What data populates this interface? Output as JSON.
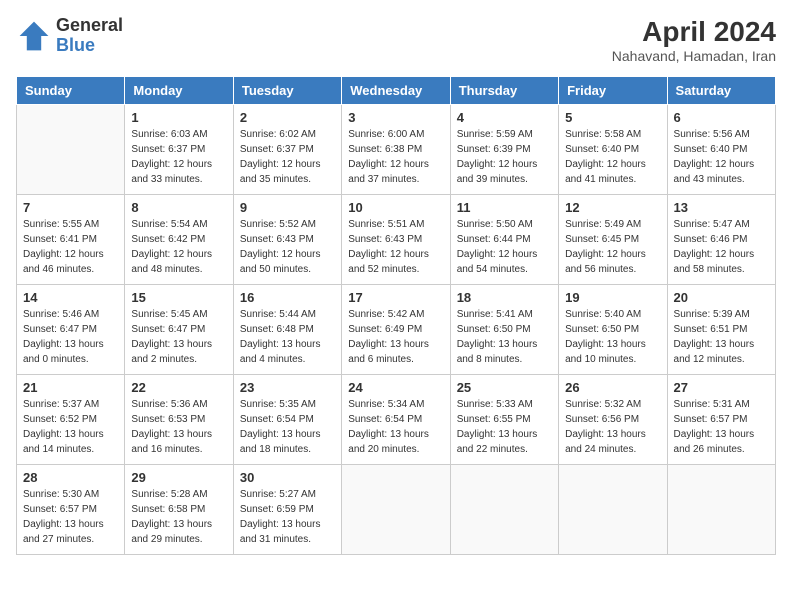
{
  "logo": {
    "line1": "General",
    "line2": "Blue"
  },
  "title": "April 2024",
  "subtitle": "Nahavand, Hamadan, Iran",
  "weekdays": [
    "Sunday",
    "Monday",
    "Tuesday",
    "Wednesday",
    "Thursday",
    "Friday",
    "Saturday"
  ],
  "weeks": [
    [
      {
        "day": "",
        "sunrise": "",
        "sunset": "",
        "daylight": ""
      },
      {
        "day": "1",
        "sunrise": "Sunrise: 6:03 AM",
        "sunset": "Sunset: 6:37 PM",
        "daylight": "Daylight: 12 hours and 33 minutes."
      },
      {
        "day": "2",
        "sunrise": "Sunrise: 6:02 AM",
        "sunset": "Sunset: 6:37 PM",
        "daylight": "Daylight: 12 hours and 35 minutes."
      },
      {
        "day": "3",
        "sunrise": "Sunrise: 6:00 AM",
        "sunset": "Sunset: 6:38 PM",
        "daylight": "Daylight: 12 hours and 37 minutes."
      },
      {
        "day": "4",
        "sunrise": "Sunrise: 5:59 AM",
        "sunset": "Sunset: 6:39 PM",
        "daylight": "Daylight: 12 hours and 39 minutes."
      },
      {
        "day": "5",
        "sunrise": "Sunrise: 5:58 AM",
        "sunset": "Sunset: 6:40 PM",
        "daylight": "Daylight: 12 hours and 41 minutes."
      },
      {
        "day": "6",
        "sunrise": "Sunrise: 5:56 AM",
        "sunset": "Sunset: 6:40 PM",
        "daylight": "Daylight: 12 hours and 43 minutes."
      }
    ],
    [
      {
        "day": "7",
        "sunrise": "Sunrise: 5:55 AM",
        "sunset": "Sunset: 6:41 PM",
        "daylight": "Daylight: 12 hours and 46 minutes."
      },
      {
        "day": "8",
        "sunrise": "Sunrise: 5:54 AM",
        "sunset": "Sunset: 6:42 PM",
        "daylight": "Daylight: 12 hours and 48 minutes."
      },
      {
        "day": "9",
        "sunrise": "Sunrise: 5:52 AM",
        "sunset": "Sunset: 6:43 PM",
        "daylight": "Daylight: 12 hours and 50 minutes."
      },
      {
        "day": "10",
        "sunrise": "Sunrise: 5:51 AM",
        "sunset": "Sunset: 6:43 PM",
        "daylight": "Daylight: 12 hours and 52 minutes."
      },
      {
        "day": "11",
        "sunrise": "Sunrise: 5:50 AM",
        "sunset": "Sunset: 6:44 PM",
        "daylight": "Daylight: 12 hours and 54 minutes."
      },
      {
        "day": "12",
        "sunrise": "Sunrise: 5:49 AM",
        "sunset": "Sunset: 6:45 PM",
        "daylight": "Daylight: 12 hours and 56 minutes."
      },
      {
        "day": "13",
        "sunrise": "Sunrise: 5:47 AM",
        "sunset": "Sunset: 6:46 PM",
        "daylight": "Daylight: 12 hours and 58 minutes."
      }
    ],
    [
      {
        "day": "14",
        "sunrise": "Sunrise: 5:46 AM",
        "sunset": "Sunset: 6:47 PM",
        "daylight": "Daylight: 13 hours and 0 minutes."
      },
      {
        "day": "15",
        "sunrise": "Sunrise: 5:45 AM",
        "sunset": "Sunset: 6:47 PM",
        "daylight": "Daylight: 13 hours and 2 minutes."
      },
      {
        "day": "16",
        "sunrise": "Sunrise: 5:44 AM",
        "sunset": "Sunset: 6:48 PM",
        "daylight": "Daylight: 13 hours and 4 minutes."
      },
      {
        "day": "17",
        "sunrise": "Sunrise: 5:42 AM",
        "sunset": "Sunset: 6:49 PM",
        "daylight": "Daylight: 13 hours and 6 minutes."
      },
      {
        "day": "18",
        "sunrise": "Sunrise: 5:41 AM",
        "sunset": "Sunset: 6:50 PM",
        "daylight": "Daylight: 13 hours and 8 minutes."
      },
      {
        "day": "19",
        "sunrise": "Sunrise: 5:40 AM",
        "sunset": "Sunset: 6:50 PM",
        "daylight": "Daylight: 13 hours and 10 minutes."
      },
      {
        "day": "20",
        "sunrise": "Sunrise: 5:39 AM",
        "sunset": "Sunset: 6:51 PM",
        "daylight": "Daylight: 13 hours and 12 minutes."
      }
    ],
    [
      {
        "day": "21",
        "sunrise": "Sunrise: 5:37 AM",
        "sunset": "Sunset: 6:52 PM",
        "daylight": "Daylight: 13 hours and 14 minutes."
      },
      {
        "day": "22",
        "sunrise": "Sunrise: 5:36 AM",
        "sunset": "Sunset: 6:53 PM",
        "daylight": "Daylight: 13 hours and 16 minutes."
      },
      {
        "day": "23",
        "sunrise": "Sunrise: 5:35 AM",
        "sunset": "Sunset: 6:54 PM",
        "daylight": "Daylight: 13 hours and 18 minutes."
      },
      {
        "day": "24",
        "sunrise": "Sunrise: 5:34 AM",
        "sunset": "Sunset: 6:54 PM",
        "daylight": "Daylight: 13 hours and 20 minutes."
      },
      {
        "day": "25",
        "sunrise": "Sunrise: 5:33 AM",
        "sunset": "Sunset: 6:55 PM",
        "daylight": "Daylight: 13 hours and 22 minutes."
      },
      {
        "day": "26",
        "sunrise": "Sunrise: 5:32 AM",
        "sunset": "Sunset: 6:56 PM",
        "daylight": "Daylight: 13 hours and 24 minutes."
      },
      {
        "day": "27",
        "sunrise": "Sunrise: 5:31 AM",
        "sunset": "Sunset: 6:57 PM",
        "daylight": "Daylight: 13 hours and 26 minutes."
      }
    ],
    [
      {
        "day": "28",
        "sunrise": "Sunrise: 5:30 AM",
        "sunset": "Sunset: 6:57 PM",
        "daylight": "Daylight: 13 hours and 27 minutes."
      },
      {
        "day": "29",
        "sunrise": "Sunrise: 5:28 AM",
        "sunset": "Sunset: 6:58 PM",
        "daylight": "Daylight: 13 hours and 29 minutes."
      },
      {
        "day": "30",
        "sunrise": "Sunrise: 5:27 AM",
        "sunset": "Sunset: 6:59 PM",
        "daylight": "Daylight: 13 hours and 31 minutes."
      },
      {
        "day": "",
        "sunrise": "",
        "sunset": "",
        "daylight": ""
      },
      {
        "day": "",
        "sunrise": "",
        "sunset": "",
        "daylight": ""
      },
      {
        "day": "",
        "sunrise": "",
        "sunset": "",
        "daylight": ""
      },
      {
        "day": "",
        "sunrise": "",
        "sunset": "",
        "daylight": ""
      }
    ]
  ]
}
